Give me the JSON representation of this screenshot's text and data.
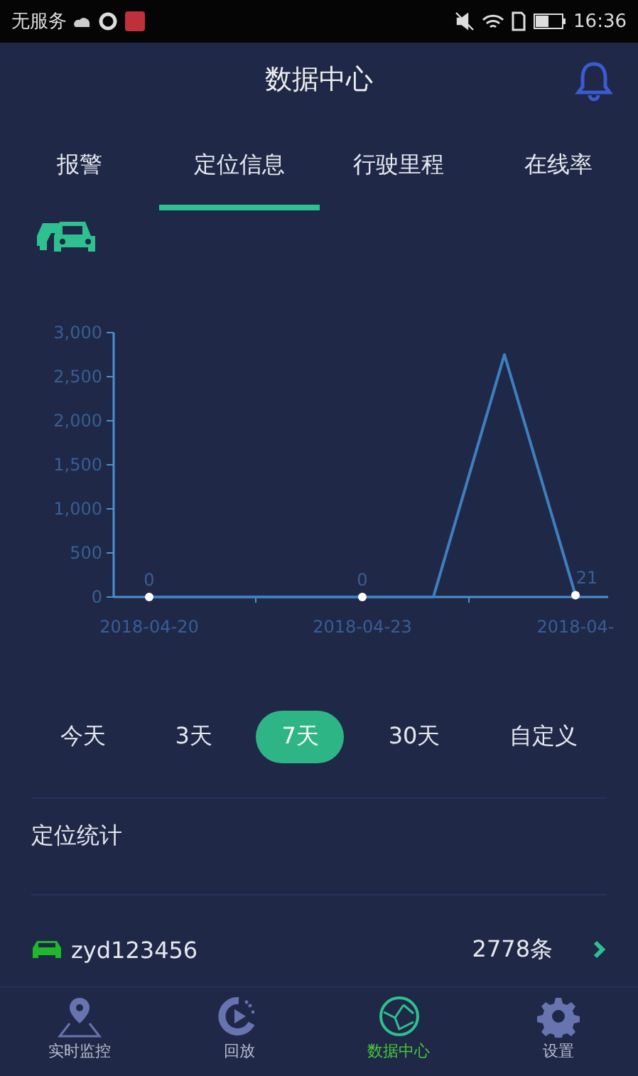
{
  "status_bar": {
    "carrier": "无服务",
    "time": "16:36"
  },
  "header": {
    "title": "数据中心"
  },
  "tabs": [
    {
      "label": "报警",
      "selected": false
    },
    {
      "label": "定位信息",
      "selected": true
    },
    {
      "label": "行驶里程",
      "selected": false
    },
    {
      "label": "在线率",
      "selected": false
    }
  ],
  "chart": {
    "chart_data": {
      "type": "line",
      "categories": [
        "2018-04-20",
        null,
        null,
        "2018-04-23",
        null,
        null,
        "2018-04-"
      ],
      "series": [
        {
          "color": "#3d7fc0",
          "values": [
            0,
            0,
            0,
            0,
            0,
            2750,
            21
          ]
        }
      ],
      "ylim": [
        0,
        3000
      ],
      "yticks": [
        {
          "value": 0,
          "label": "0"
        },
        {
          "value": 500,
          "label": "500"
        },
        {
          "value": 1000,
          "label": "1,000"
        },
        {
          "value": 1500,
          "label": "1,500"
        },
        {
          "value": 2000,
          "label": "2,000"
        },
        {
          "value": 2500,
          "label": "2,500"
        },
        {
          "value": 3000,
          "label": "3,000"
        }
      ],
      "value_labels": [
        "0",
        null,
        null,
        "0",
        null,
        null,
        "21"
      ]
    }
  },
  "ranges": [
    {
      "label": "今天",
      "selected": false
    },
    {
      "label": "3天",
      "selected": false
    },
    {
      "label": "7天",
      "selected": true
    },
    {
      "label": "30天",
      "selected": false
    },
    {
      "label": "自定义",
      "selected": false
    }
  ],
  "stats": {
    "title": "定位统计",
    "rows": [
      {
        "vehicle": "zyd123456",
        "count": "2778条"
      }
    ]
  },
  "nav": [
    {
      "label": "实时监控",
      "kind": "pin",
      "selected": false
    },
    {
      "label": "回放",
      "kind": "replay",
      "selected": false
    },
    {
      "label": "数据中心",
      "kind": "globe",
      "selected": true
    },
    {
      "label": "设置",
      "kind": "gear",
      "selected": false
    }
  ]
}
